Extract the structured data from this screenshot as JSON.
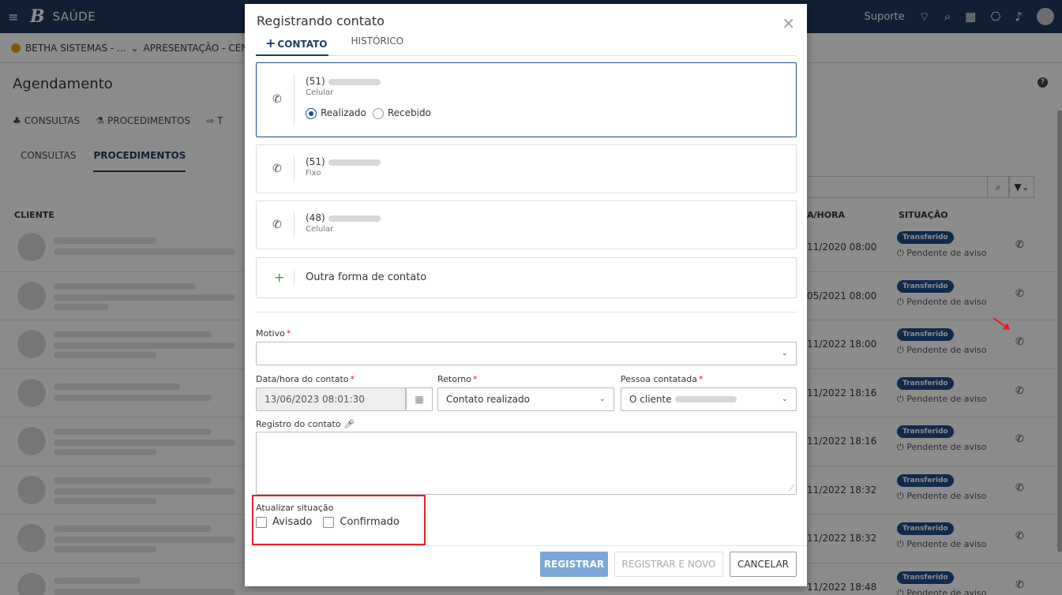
{
  "app": {
    "name": "SAÚDE",
    "logo_letter": "B",
    "support_label": "Suporte",
    "entity": "BETHA SISTEMAS - ...",
    "context": "APRESENTAÇÃO - CEN"
  },
  "page": {
    "title": "Agendamento",
    "tabs_level1": [
      "CONSULTAS",
      "PROCEDIMENTOS",
      "T"
    ],
    "tabs_level2": [
      "CONSULTAS",
      "PROCEDIMENTOS"
    ],
    "active_tab_level2": "PROCEDIMENTOS",
    "columns": {
      "cliente": "CLIENTE",
      "data": "A/HORA",
      "situacao": "SITUAÇÃO"
    },
    "rows": [
      {
        "datetime": "11/2020 08:00",
        "status": "Transferido",
        "sub": "Pendente de aviso"
      },
      {
        "datetime": "05/2021 08:00",
        "status": "Transferido",
        "sub": "Pendente de aviso"
      },
      {
        "datetime": "11/2022 18:00",
        "status": "Transferido",
        "sub": "Pendente de aviso"
      },
      {
        "datetime": "11/2022 18:16",
        "status": "Transferido",
        "sub": "Pendente de aviso"
      },
      {
        "datetime": "11/2022 18:16",
        "status": "Transferido",
        "sub": "Pendente de aviso"
      },
      {
        "datetime": "11/2022 18:32",
        "status": "Transferido",
        "sub": "Pendente de aviso"
      },
      {
        "datetime": "11/2022 18:32",
        "status": "Transferido",
        "sub": "Pendente de aviso"
      },
      {
        "datetime": "11/2022 18:48",
        "status": "Transferido",
        "sub": "Pendente de aviso"
      }
    ]
  },
  "modal": {
    "title": "Registrando contato",
    "tabs": {
      "contato": "CONTATO",
      "historico": "HISTÓRICO"
    },
    "contacts": [
      {
        "prefix": "(51)",
        "type": "Celular"
      },
      {
        "prefix": "(51)",
        "type": "Fixo"
      },
      {
        "prefix": "(48)",
        "type": "Celular"
      }
    ],
    "radio_realizado": "Realizado",
    "radio_recebido": "Recebido",
    "other_contact": "Outra forma de contato",
    "motivo_label": "Motivo",
    "data_label": "Data/hora do contato",
    "data_value": "13/06/2023 08:01:30",
    "retorno_label": "Retorno",
    "retorno_value": "Contato realizado",
    "pessoa_label": "Pessoa contatada",
    "pessoa_value": "O cliente",
    "registro_label": "Registro do contato",
    "atualizar_label": "Atualizar situação",
    "check_avisado": "Avisado",
    "check_confirmado": "Confirmado",
    "btn_registrar": "REGISTRAR",
    "btn_registrar_novo": "REGISTRAR E NOVO",
    "btn_cancelar": "CANCELAR"
  },
  "colors": {
    "topbar": "#1e3a5f",
    "primary": "#1e4e8c",
    "highlight": "#e02020",
    "badge": "#1e4e8c"
  }
}
